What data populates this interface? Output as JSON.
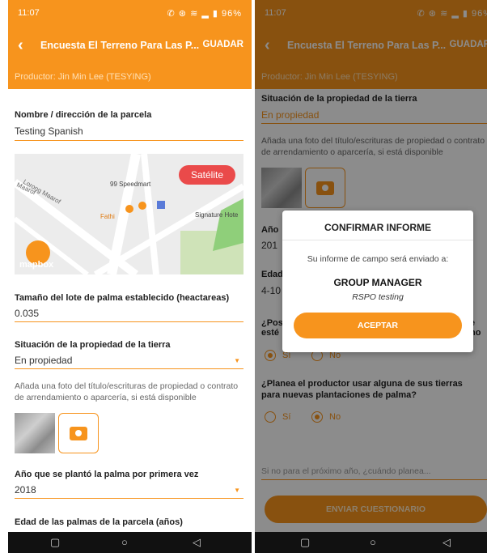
{
  "status_bar": {
    "time": "11:07",
    "icons": "✆ ⊛ ≋ ▂ ▮ 96%",
    "battery": "96%"
  },
  "app_bar": {
    "back_icon": "‹",
    "title": "Encuesta El Terreno Para Las P...",
    "save_label": "GUADAR"
  },
  "producer": "Productor: Jin Min Lee (TESYING)",
  "left": {
    "parcel_label": "Nombre / dirección de la parcela",
    "parcel_value": "Testing Spanish",
    "map": {
      "satellite_button": "Satélite",
      "labels": [
        "Lorong Maarof",
        "Maarof",
        "99 Speedmart",
        "Fathi",
        "Signature Hote"
      ],
      "attribution": "mapbox"
    },
    "lot_size_label": "Tamaño del lote de palma establecido (heactareas)",
    "lot_size_value": "0.035",
    "ownership_label": "Situación de la propiedad de la tierra",
    "ownership_value": "En propiedad",
    "photo_hint": "Añada una foto del título/escrituras de propiedad o contrato de arrendamiento o aparcería, si está disponible",
    "planted_year_label": "Año que se plantó la palma por primera vez",
    "planted_year_value": "2018",
    "palm_age_label": "Edad de las palmas de la parcela (años)"
  },
  "right": {
    "ownership_label": "Situación de la propiedad de la tierra",
    "ownership_value": "En propiedad",
    "photo_hint": "Añada una foto del título/escrituras de propiedad o contrato de arrendamiento o aparcería, si está disponible",
    "partial_year_label": "Año",
    "partial_year_value": "201",
    "partial_age_label": "Edad",
    "partial_age_value": "4-10",
    "partial_q_line1": "¿Pos",
    "partial_q_line2": "esté",
    "partial_q_right": "e no",
    "radio1": {
      "yes": "Sí",
      "no": "No"
    },
    "new_plantations_q": "¿Planea el productor usar alguna de sus tierras para nuevas plantaciones de palma?",
    "radio2": {
      "yes": "Sí",
      "no": "No"
    },
    "next_year_placeholder": "Si no para el próximo año, ¿cuándo planea...",
    "submit_label": "ENVIAR CUESTIONARIO"
  },
  "dialog": {
    "title": "CONFIRMAR INFORME",
    "message": "Su informe de campo será enviado a:",
    "group": "GROUP MANAGER",
    "subgroup": "RSPO testing",
    "accept_label": "ACEPTAR"
  },
  "nav": {
    "square": "▢",
    "circle": "○",
    "back": "◁"
  },
  "colors": {
    "accent": "#f7941d",
    "satellite": "#ea4a4a"
  }
}
